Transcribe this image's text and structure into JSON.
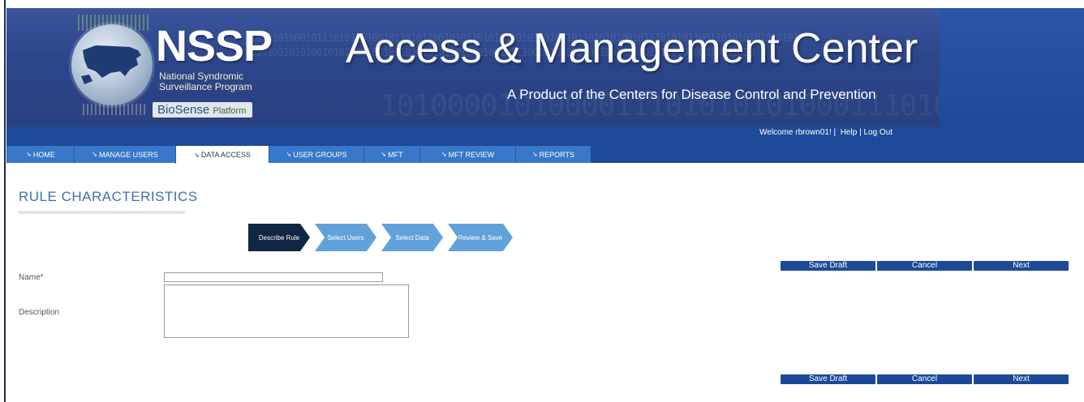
{
  "header": {
    "logo_acronym": "NSSP",
    "logo_subtitle_1": "National Syndromic",
    "logo_subtitle_2": "Surveillance Program",
    "logo_platform_name": "BioSense",
    "logo_platform_suffix": "Platform",
    "title": "Access & Management Center",
    "subtitle": "A Product of the Centers for Disease Control and Prevention",
    "bg_color": "#2c458a"
  },
  "user_bar": {
    "welcome": "Welcome rbrown01!",
    "separator": "|",
    "help": "Help",
    "pipe": "|",
    "logout": "Log Out"
  },
  "nav": {
    "tabs": [
      {
        "label": "HOME",
        "active": false
      },
      {
        "label": "MANAGE USERS",
        "active": false
      },
      {
        "label": "DATA ACCESS",
        "active": true
      },
      {
        "label": "USER GROUPS",
        "active": false
      },
      {
        "label": "MFT",
        "active": false
      },
      {
        "label": "MFT REVIEW",
        "active": false
      },
      {
        "label": "REPORTS",
        "active": false
      }
    ],
    "tab_color": "#3877c9",
    "active_color": "#ffffff"
  },
  "page": {
    "title": "RULE CHARACTERISTICS"
  },
  "wizard": {
    "steps": [
      {
        "label": "Describe Rule",
        "state": "current"
      },
      {
        "label": "Select Users",
        "state": "todo"
      },
      {
        "label": "Select Data",
        "state": "todo"
      },
      {
        "label": "Review & Save",
        "state": "todo"
      }
    ],
    "current_color": "#0f2744",
    "todo_color": "#62a2db"
  },
  "actions": {
    "save_draft": "Save Draft",
    "cancel": "Cancel",
    "next": "Next",
    "color": "#1d4a98"
  },
  "form": {
    "name_label": "Name*",
    "name_value": "",
    "description_label": "Description",
    "description_value": ""
  }
}
